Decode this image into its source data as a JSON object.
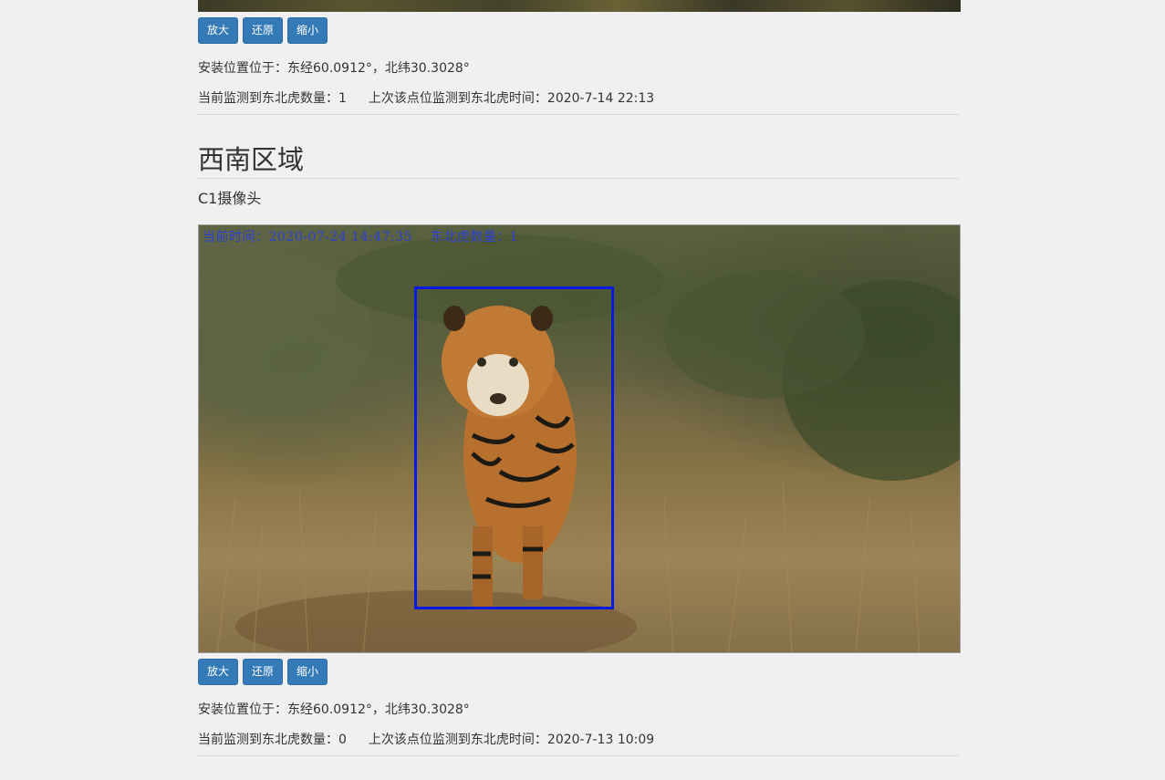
{
  "top_section": {
    "buttons": {
      "zoom_in": "放大",
      "reset": "还原",
      "zoom_out": "缩小"
    },
    "location": "安装位置位于：东经60.0912°，北纬30.3028°",
    "count_text": "当前监测到东北虎数量：1",
    "last_seen_text": "上次该点位监测到东北虎时间：2020-7-14 22:13"
  },
  "region": {
    "title": "西南区域",
    "camera": "C1摄像头",
    "video": {
      "overlay_time": "当前时间：2020-07-24 14:47:35",
      "overlay_count": "东北虎数量：1",
      "detection_color": "#0a1be0"
    },
    "buttons": {
      "zoom_in": "放大",
      "reset": "还原",
      "zoom_out": "缩小"
    },
    "location": "安装位置位于：东经60.0912°，北纬30.3028°",
    "count_text": "当前监测到东北虎数量：0",
    "last_seen_text": "上次该点位监测到东北虎时间：2020-7-13 10:09"
  },
  "colors": {
    "button": "#337ab7",
    "background": "#f0f0f0"
  }
}
